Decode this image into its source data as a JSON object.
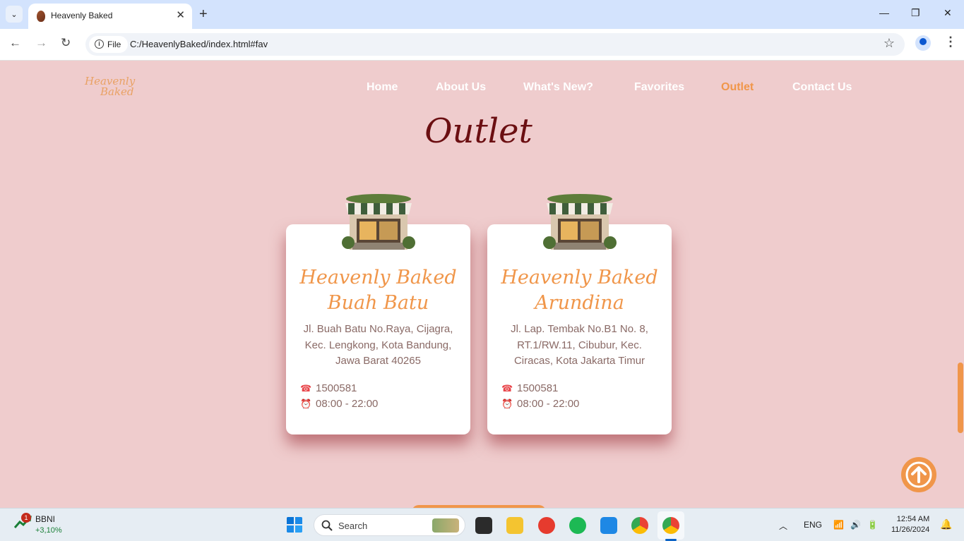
{
  "browser": {
    "tab_title": "Heavenly Baked",
    "url_chip": "File",
    "url": "C:/HeavenlyBaked/index.html#fav",
    "new_tab": "+",
    "tab_close": "✕"
  },
  "site": {
    "logo_line1": "Heavenly",
    "logo_line2": "Baked",
    "nav": [
      "Home",
      "About Us",
      "What's New?",
      "Favorites",
      "Outlet",
      "Contact Us"
    ],
    "active_nav": "Outlet",
    "section_title": "Outlet",
    "outlets": [
      {
        "title_line1": "Heavenly Baked",
        "title_line2": "Buah Batu",
        "address": "Jl. Buah Batu No.Raya, Cijagra, Kec. Lengkong, Kota Bandung, Jawa Barat 40265",
        "phone": "1500581",
        "hours": "08:00 - 22:00"
      },
      {
        "title_line1": "Heavenly Baked",
        "title_line2": "Arundina",
        "address": "Jl. Lap. Tembak No.B1 No. 8, RT.1/RW.11, Cibubur, Kec. Ciracas, Kota Jakarta Timur",
        "phone": "1500581",
        "hours": "08:00 - 22:00"
      }
    ]
  },
  "taskbar": {
    "stock_name": "BBNI",
    "stock_change": "+3,10%",
    "stock_notif": "1",
    "search_placeholder": "Search",
    "language": "ENG",
    "time": "12:54 AM",
    "date": "11/26/2024"
  },
  "colors": {
    "page_bg": "#efcccd",
    "accent": "#f0964a",
    "title": "#6b0f12"
  }
}
